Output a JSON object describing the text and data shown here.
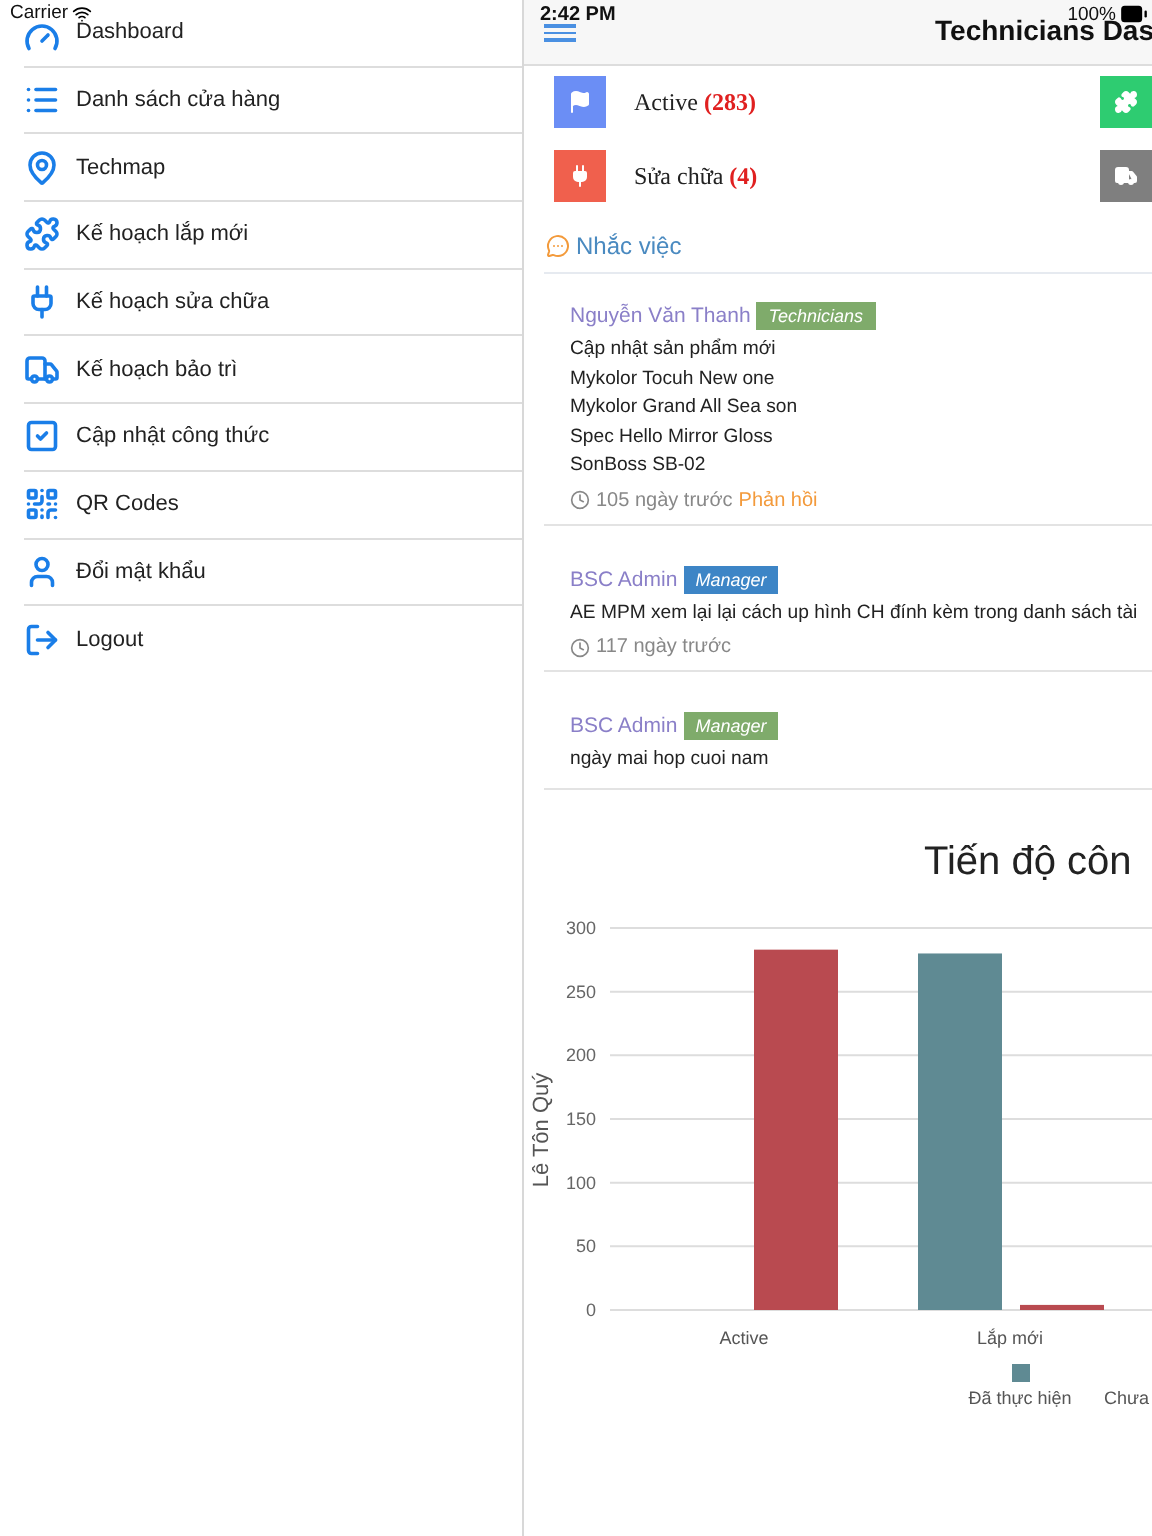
{
  "status_bar": {
    "carrier": "Carrier",
    "time": "2:42 PM",
    "battery": "100%"
  },
  "sidebar": {
    "items": [
      {
        "label": "Dashboard"
      },
      {
        "label": "Danh sách cửa hàng"
      },
      {
        "label": "Techmap"
      },
      {
        "label": "Kế hoạch lắp mới"
      },
      {
        "label": "Kế hoạch sửa chữa"
      },
      {
        "label": "Kế hoạch bảo trì"
      },
      {
        "label": "Cập nhật công thức"
      },
      {
        "label": "QR Codes"
      },
      {
        "label": "Đổi mật khẩu"
      },
      {
        "label": "Logout"
      }
    ]
  },
  "header": {
    "title": "Technicians Das"
  },
  "summary": [
    {
      "label": "Active",
      "count": "(283)",
      "color": "#6b8ef5"
    },
    {
      "label": "Sửa chữa",
      "count": "(4)",
      "color": "#f0604d"
    }
  ],
  "summary_column_2": [
    {
      "color": "#2ecc71"
    },
    {
      "color": "#7f7f7f"
    }
  ],
  "reminders": {
    "title": "Nhắc việc",
    "messages": [
      {
        "author": "Nguyễn Văn Thanh",
        "role": "Technicians",
        "color": "#7fab6b",
        "lines": [
          "Cập nhật sản phẩm mới",
          "Mykolor Tocuh New one",
          "Mykolor Grand All Sea son",
          "Spec Hello Mirror Gloss",
          "SonBoss SB-02"
        ],
        "time": "105 ngày trước",
        "reply": "Phản hồi"
      },
      {
        "author": "BSC Admin",
        "role": "Manager",
        "color": "#3d85c6",
        "lines": [
          "AE MPM xem lại lại cách up hình CH đính kèm trong danh sách tài"
        ],
        "time": "117 ngày trước"
      },
      {
        "author": "BSC Admin",
        "role": "Manager",
        "color": "#7fab6b",
        "lines": [
          "ngày mai hop cuoi nam"
        ]
      }
    ]
  },
  "chart": {
    "chart_data": {
      "type": "bar",
      "title": "Tiến độ côn",
      "ylabel": "Lê Tôn Quý",
      "categories": [
        "Active",
        "Lắp mới"
      ],
      "series": [
        {
          "name": "Đã thực hiện",
          "color": "#5f8a93",
          "values": [
            null,
            280
          ]
        },
        {
          "name": "Chưa",
          "color": "#b94a50",
          "values": [
            283,
            4
          ]
        }
      ],
      "ylim": [
        0,
        300
      ],
      "grid": true,
      "yticks": [
        0,
        50,
        100,
        150,
        200,
        250,
        300
      ]
    }
  }
}
